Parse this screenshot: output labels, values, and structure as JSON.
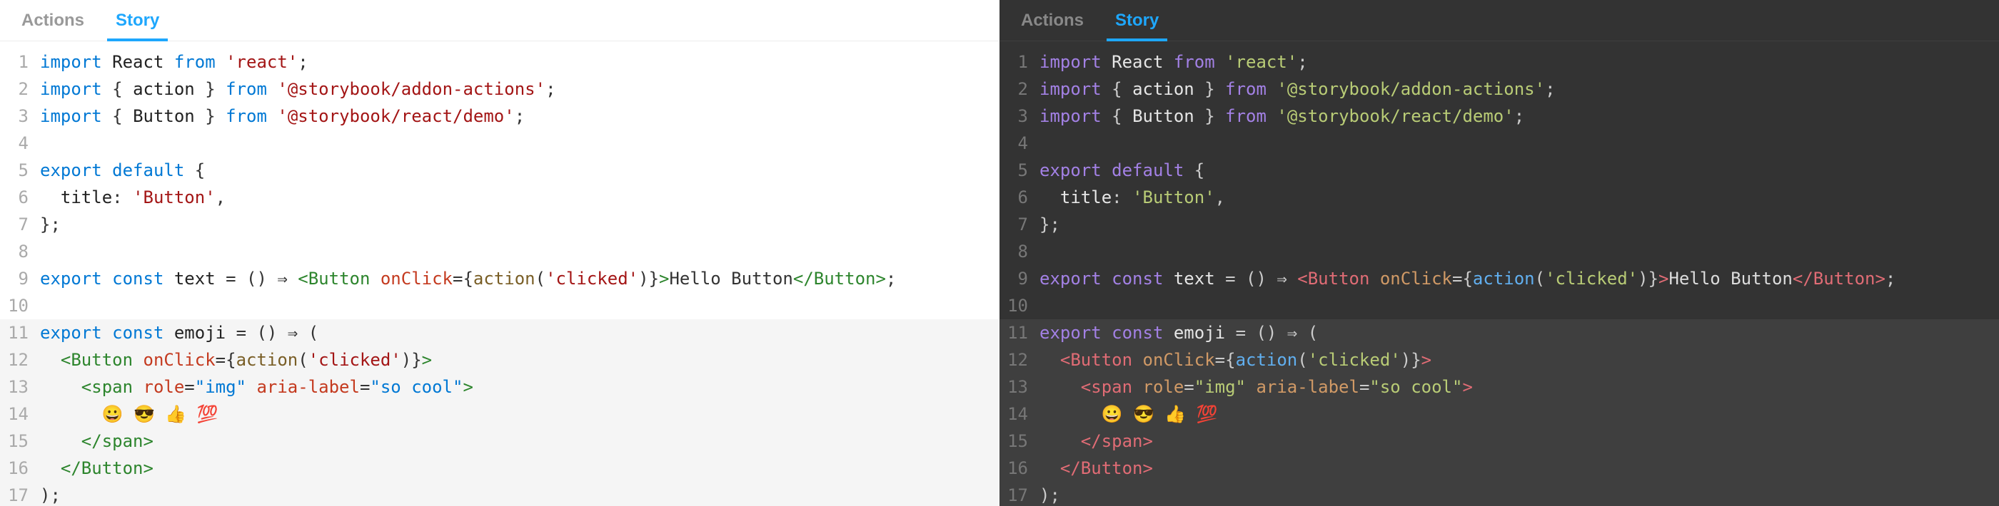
{
  "tabs": [
    {
      "id": "actions",
      "label": "Actions",
      "active": false
    },
    {
      "id": "story",
      "label": "Story",
      "active": true
    }
  ],
  "highlighted_lines": [
    11,
    12,
    13,
    14,
    15,
    16,
    17
  ],
  "code_lines": [
    {
      "n": 1,
      "tokens": [
        [
          "kw",
          "import"
        ],
        [
          "text",
          " "
        ],
        [
          "def",
          "React"
        ],
        [
          "text",
          " "
        ],
        [
          "kw",
          "from"
        ],
        [
          "text",
          " "
        ],
        [
          "str",
          "'react'"
        ],
        [
          "pun",
          ";"
        ]
      ]
    },
    {
      "n": 2,
      "tokens": [
        [
          "kw",
          "import"
        ],
        [
          "text",
          " "
        ],
        [
          "pun",
          "{ "
        ],
        [
          "def",
          "action"
        ],
        [
          "pun",
          " }"
        ],
        [
          "text",
          " "
        ],
        [
          "kw",
          "from"
        ],
        [
          "text",
          " "
        ],
        [
          "str",
          "'@storybook/addon-actions'"
        ],
        [
          "pun",
          ";"
        ]
      ]
    },
    {
      "n": 3,
      "tokens": [
        [
          "kw",
          "import"
        ],
        [
          "text",
          " "
        ],
        [
          "pun",
          "{ "
        ],
        [
          "def",
          "Button"
        ],
        [
          "pun",
          " }"
        ],
        [
          "text",
          " "
        ],
        [
          "kw",
          "from"
        ],
        [
          "text",
          " "
        ],
        [
          "str",
          "'@storybook/react/demo'"
        ],
        [
          "pun",
          ";"
        ]
      ]
    },
    {
      "n": 4,
      "tokens": []
    },
    {
      "n": 5,
      "tokens": [
        [
          "kw",
          "export"
        ],
        [
          "text",
          " "
        ],
        [
          "kw",
          "default"
        ],
        [
          "text",
          " "
        ],
        [
          "pun",
          "{"
        ]
      ]
    },
    {
      "n": 6,
      "tokens": [
        [
          "text",
          "  "
        ],
        [
          "def",
          "title"
        ],
        [
          "pun",
          ": "
        ],
        [
          "str",
          "'Button'"
        ],
        [
          "pun",
          ","
        ]
      ]
    },
    {
      "n": 7,
      "tokens": [
        [
          "pun",
          "};"
        ]
      ]
    },
    {
      "n": 8,
      "tokens": []
    },
    {
      "n": 9,
      "tokens": [
        [
          "kw",
          "export"
        ],
        [
          "text",
          " "
        ],
        [
          "kw",
          "const"
        ],
        [
          "text",
          " "
        ],
        [
          "def",
          "text"
        ],
        [
          "text",
          " "
        ],
        [
          "pun",
          "= () ⇒ "
        ],
        [
          "tag",
          "<Button "
        ],
        [
          "attr",
          "onClick"
        ],
        [
          "pun",
          "="
        ],
        [
          "pun",
          "{"
        ],
        [
          "call",
          "action"
        ],
        [
          "pun",
          "("
        ],
        [
          "str",
          "'clicked'"
        ],
        [
          "pun",
          ")"
        ],
        [
          "pun",
          "}"
        ],
        [
          "tag",
          ">"
        ],
        [
          "text",
          "Hello Button"
        ],
        [
          "tag",
          "</Button>"
        ],
        [
          "pun",
          ";"
        ]
      ]
    },
    {
      "n": 10,
      "tokens": []
    },
    {
      "n": 11,
      "tokens": [
        [
          "kw",
          "export"
        ],
        [
          "text",
          " "
        ],
        [
          "kw",
          "const"
        ],
        [
          "text",
          " "
        ],
        [
          "def",
          "emoji"
        ],
        [
          "text",
          " "
        ],
        [
          "pun",
          "= () ⇒ ("
        ]
      ]
    },
    {
      "n": 12,
      "tokens": [
        [
          "text",
          "  "
        ],
        [
          "tag",
          "<Button "
        ],
        [
          "attr",
          "onClick"
        ],
        [
          "pun",
          "="
        ],
        [
          "pun",
          "{"
        ],
        [
          "call",
          "action"
        ],
        [
          "pun",
          "("
        ],
        [
          "str",
          "'clicked'"
        ],
        [
          "pun",
          ")"
        ],
        [
          "pun",
          "}"
        ],
        [
          "tag",
          ">"
        ]
      ]
    },
    {
      "n": 13,
      "tokens": [
        [
          "text",
          "    "
        ],
        [
          "tag",
          "<span "
        ],
        [
          "attr",
          "role"
        ],
        [
          "pun",
          "="
        ],
        [
          "attrval",
          "\"img\""
        ],
        [
          "text",
          " "
        ],
        [
          "attr",
          "aria-label"
        ],
        [
          "pun",
          "="
        ],
        [
          "attrval",
          "\"so cool\""
        ],
        [
          "tag",
          ">"
        ]
      ]
    },
    {
      "n": 14,
      "tokens": [
        [
          "text",
          "      "
        ],
        [
          "text",
          "😀 😎 👍 💯"
        ]
      ]
    },
    {
      "n": 15,
      "tokens": [
        [
          "text",
          "    "
        ],
        [
          "tag",
          "</span>"
        ]
      ]
    },
    {
      "n": 16,
      "tokens": [
        [
          "text",
          "  "
        ],
        [
          "tag",
          "</Button>"
        ]
      ]
    },
    {
      "n": 17,
      "tokens": [
        [
          "pun",
          ");"
        ]
      ]
    }
  ]
}
